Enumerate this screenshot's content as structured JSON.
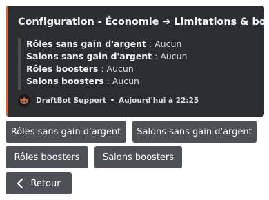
{
  "embed": {
    "accent_color": "#c16d47",
    "title": "Configuration - Économie ➔ Limitations & boosts",
    "fields": [
      {
        "label": "Rôles sans gain d'argent",
        "value": " : Aucun"
      },
      {
        "label": "Salons sans gain d'argent",
        "value": " : Aucun"
      },
      {
        "label": "Rôles boosters",
        "value": " : Aucun"
      },
      {
        "label": "Salons boosters",
        "value": " : Aucun"
      }
    ],
    "footer": {
      "avatar_icon": "draftbot-avatar-icon",
      "author": "DraftBot Support",
      "separator": "•",
      "timestamp": "Aujourd'hui à 22:25"
    }
  },
  "buttons": {
    "roles_no_gain": "Rôles sans gain d'argent",
    "salons_no_gain": "Salons sans gain d'argent",
    "roles_boosters": "Rôles boosters",
    "salons_boosters": "Salons boosters",
    "back": "Retour",
    "back_icon": "chevron-left-icon"
  }
}
